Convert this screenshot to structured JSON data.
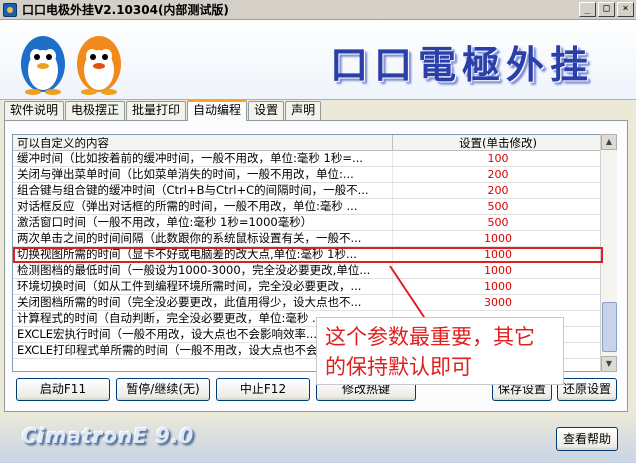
{
  "window": {
    "title": "口口电极外挂V2.10304(内部测试版)"
  },
  "banner": {
    "brand_text": "口口電極外挂"
  },
  "tabs": [
    {
      "label": "软件说明"
    },
    {
      "label": "电极摆正"
    },
    {
      "label": "批量打印"
    },
    {
      "label": "自动编程",
      "active": true
    },
    {
      "label": "设置"
    },
    {
      "label": "声明"
    }
  ],
  "table": {
    "header_item": "可以自定义的内容",
    "header_value": "设置(单击修改)",
    "rows": [
      {
        "item": "缓冲时间（比如按着前的缓冲时间，一般不用改，单位:毫秒 1秒=...",
        "value": "100"
      },
      {
        "item": "关闭与弹出菜单时间（比如菜单消失的时间，一般不用改，单位:...",
        "value": "200"
      },
      {
        "item": "组合键与组合键的缓冲时间（Ctrl+B与Ctrl+C的间隔时间，一般不...",
        "value": "200"
      },
      {
        "item": "对话框反应（弹出对话框的所需的时间，一般不用改，单位:毫秒 ...",
        "value": "500"
      },
      {
        "item": "激活窗口时间（一般不用改，单位:毫秒 1秒=1000毫秒）",
        "value": "500"
      },
      {
        "item": "两次单击之间的时间间隔（此数跟你的系统鼠标设置有关，一般不...",
        "value": "1000"
      },
      {
        "item": "切换视图所需的时间（显卡不好或电脑差的改大点,单位:毫秒 1秒...",
        "value": "1000",
        "highlight": true
      },
      {
        "item": "检测图档的最低时间（一般设为1000-3000，完全没必要更改,单位...",
        "value": "1000"
      },
      {
        "item": "环境切换时间（如从工件到编程环境所需时间，完全没必要更改，...",
        "value": "1000"
      },
      {
        "item": "关闭图档所需的时间（完全没必要更改，此值用得少，设大点也不...",
        "value": "3000"
      },
      {
        "item": "计算程式的时间（自动判断，完全没必要更改，单位:毫秒 ...",
        "value": ""
      },
      {
        "item": "EXCLE宏执行时间（一般不用改，设大点也不会影响效率...",
        "value": ""
      },
      {
        "item": "EXCLE打印程式单所需的时间（一般不用改，设大点也不会...",
        "value": ""
      }
    ]
  },
  "annotation": {
    "text": "这个参数最重要，其它的保持默认即可"
  },
  "buttons": {
    "start": "启动F11",
    "pause": "暂停/继续(无)",
    "stop": "中止F12",
    "modify_hotkey": "修改热键",
    "save": "保存设置",
    "restore": "还原设置",
    "help": "查看帮助"
  },
  "footer": {
    "logo_text": "CimatronE 9.0"
  }
}
